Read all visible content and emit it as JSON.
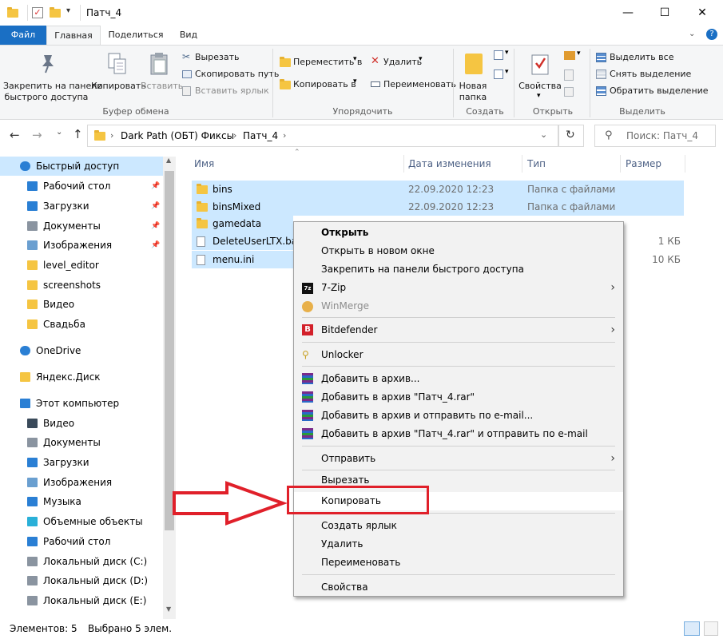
{
  "window": {
    "title": "Патч_4",
    "min": "—",
    "max": "☐",
    "close": "✕"
  },
  "tabs": [
    {
      "label": "Файл"
    },
    {
      "label": "Главная"
    },
    {
      "label": "Поделиться"
    },
    {
      "label": "Вид"
    }
  ],
  "ribbon": {
    "pin": "Закрепить на панели быстрого доступа",
    "pin_l1": "Закрепить на панели",
    "pin_l2": "быстрого доступа",
    "copy": "Копировать",
    "paste": "Вставить",
    "cut": "Вырезать",
    "copy_path": "Скопировать путь",
    "paste_shortcut": "Вставить ярлык",
    "group_clipboard": "Буфер обмена",
    "move_to": "Переместить в",
    "copy_to": "Копировать в",
    "delete": "Удалить",
    "rename": "Переименовать",
    "group_organize": "Упорядочить",
    "new_folder_l1": "Новая",
    "new_folder_l2": "папка",
    "group_create": "Создать",
    "properties": "Свойства",
    "group_open": "Открыть",
    "select_all": "Выделить все",
    "select_none": "Снять выделение",
    "invert": "Обратить выделение",
    "group_select": "Выделить"
  },
  "address": {
    "crumbs": [
      "Dark Path (ОБТ) Фиксы",
      "Патч_4"
    ],
    "search_placeholder": "Поиск: Патч_4"
  },
  "nav": [
    {
      "label": "Быстрый доступ",
      "icon": "star-icon"
    },
    {
      "label": "Рабочий стол",
      "icon": "desktop-icon",
      "pinned": true
    },
    {
      "label": "Загрузки",
      "icon": "download-icon",
      "pinned": true
    },
    {
      "label": "Документы",
      "icon": "documents-icon",
      "pinned": true
    },
    {
      "label": "Изображения",
      "icon": "pictures-icon",
      "pinned": true
    },
    {
      "label": "level_editor",
      "icon": "folder-icon"
    },
    {
      "label": "screenshots",
      "icon": "folder-icon"
    },
    {
      "label": "Видео",
      "icon": "folder-icon"
    },
    {
      "label": "Свадьба",
      "icon": "folder-icon"
    },
    {
      "label": "OneDrive",
      "icon": "cloud-icon"
    },
    {
      "label": "Яндекс.Диск",
      "icon": "folder-icon"
    },
    {
      "label": "Этот компьютер",
      "icon": "computer-icon"
    },
    {
      "label": "Видео",
      "icon": "video-icon"
    },
    {
      "label": "Документы",
      "icon": "documents-icon"
    },
    {
      "label": "Загрузки",
      "icon": "download-icon"
    },
    {
      "label": "Изображения",
      "icon": "pictures-icon"
    },
    {
      "label": "Музыка",
      "icon": "music-icon"
    },
    {
      "label": "Объемные объекты",
      "icon": "3d-objects-icon"
    },
    {
      "label": "Рабочий стол",
      "icon": "desktop-icon"
    },
    {
      "label": "Локальный диск (C:)",
      "icon": "drive-icon"
    },
    {
      "label": "Локальный диск (D:)",
      "icon": "drive-icon"
    },
    {
      "label": "Локальный диск (E:)",
      "icon": "drive-icon"
    }
  ],
  "columns": {
    "name": "Имя",
    "date": "Дата изменения",
    "type": "Тип",
    "size": "Размер"
  },
  "files": [
    {
      "name": "bins",
      "date": "22.09.2020 12:23",
      "type": "Папка с файлами",
      "size": ""
    },
    {
      "name": "binsMixed",
      "date": "22.09.2020 12:23",
      "type": "Папка с файлами",
      "size": ""
    },
    {
      "name": "gamedata",
      "date": "",
      "type": "",
      "size": ""
    },
    {
      "name": "DeleteUserLTX.bat",
      "date": "",
      "type": "",
      "size": "1 КБ"
    },
    {
      "name": "menu.ini",
      "date": "",
      "type": "",
      "size": "10 КБ"
    }
  ],
  "context_menu": {
    "open": "Открыть",
    "open_new": "Открыть в новом окне",
    "pin_quick": "Закрепить на панели быстрого доступа",
    "sevenzip": "7-Zip",
    "winmerge": "WinMerge",
    "bitdefender": "Bitdefender",
    "unlocker": "Unlocker",
    "rar1": "Добавить в архив...",
    "rar2": "Добавить в архив \"Патч_4.rar\"",
    "rar3": "Добавить в архив и отправить по e-mail...",
    "rar4": "Добавить в архив \"Патч_4.rar\" и отправить по e-mail",
    "send_to": "Отправить",
    "cut": "Вырезать",
    "copy": "Копировать",
    "shortcut": "Создать ярлык",
    "delete": "Удалить",
    "rename": "Переименовать",
    "properties": "Свойства"
  },
  "status": {
    "items": "Элементов: 5",
    "selected": "Выбрано 5 элем."
  },
  "colors": {
    "accent": "#1a6fc4",
    "selection": "#cce8ff",
    "highlight_box": "#e0202a",
    "arrow": "#e0202a"
  }
}
